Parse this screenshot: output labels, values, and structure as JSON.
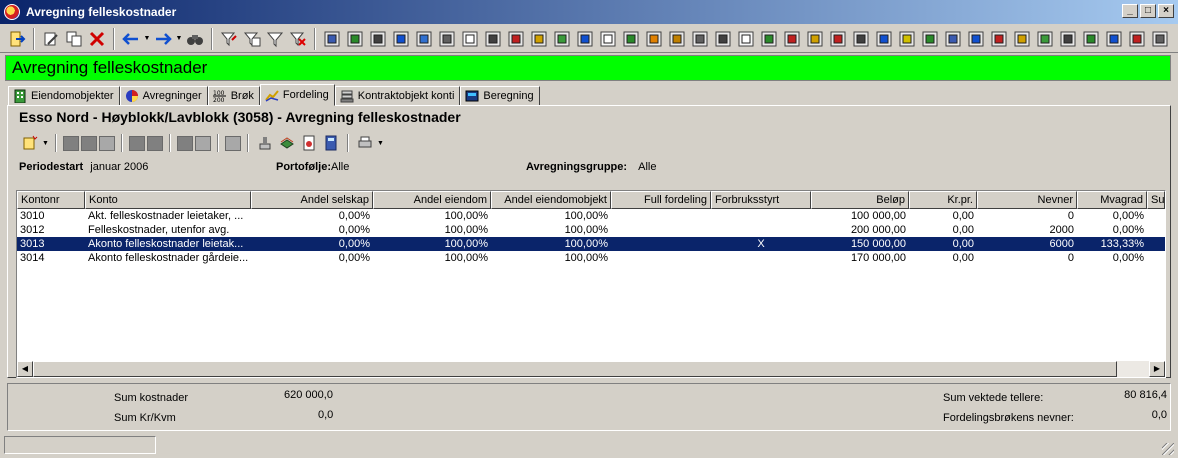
{
  "window": {
    "title": "Avregning felleskostnader"
  },
  "banner": {
    "title": "Avregning felleskostnader"
  },
  "tabs": [
    {
      "label": "Eiendomobjekter",
      "icon": "building-icon"
    },
    {
      "label": "Avregninger",
      "icon": "pie-icon"
    },
    {
      "label": "Brøk",
      "icon": "fraction-icon"
    },
    {
      "label": "Fordeling",
      "icon": "distribution-chart-icon",
      "active": true
    },
    {
      "label": "Kontraktobjekt konti",
      "icon": "stack-icon"
    },
    {
      "label": "Beregning",
      "icon": "calculator-icon"
    }
  ],
  "heading": "Esso Nord - Høyblokk/Lavblokk  (3058) - Avregning felleskostnader",
  "filters": {
    "periodestart_label": "Periodestart",
    "periodestart_value": "januar 2006",
    "portefolje_label": "Portofølje:",
    "portefolje_value": "Alle",
    "gruppe_label": "Avregningsgruppe:",
    "gruppe_value": "Alle"
  },
  "grid": {
    "columns": [
      "Kontonr",
      "Konto",
      "Andel selskap",
      "Andel eiendom",
      "Andel eiendomobjekt",
      "Full fordeling",
      "Forbruksstyrt",
      "Beløp",
      "Kr.pr.",
      "Nevner",
      "Mvagrad",
      "Su"
    ],
    "rows": [
      {
        "kontonr": "3010",
        "konto": "Akt. felleskostnader leietaker, ...",
        "andel_selskap": "0,00%",
        "andel_eiendom": "100,00%",
        "andel_eiendomobjekt": "100,00%",
        "full_fordeling": "",
        "forbruksstyrt": "",
        "belop": "100 000,00",
        "kr_pr": "0,00",
        "nevner": "0",
        "mvagrad": "0,00%",
        "selected": false
      },
      {
        "kontonr": "3012",
        "konto": "Felleskostnader, utenfor avg.",
        "andel_selskap": "0,00%",
        "andel_eiendom": "100,00%",
        "andel_eiendomobjekt": "100,00%",
        "full_fordeling": "",
        "forbruksstyrt": "",
        "belop": "200 000,00",
        "kr_pr": "0,00",
        "nevner": "2000",
        "mvagrad": "0,00%",
        "selected": false
      },
      {
        "kontonr": "3013",
        "konto": "Akonto felleskostnader leietak...",
        "andel_selskap": "0,00%",
        "andel_eiendom": "100,00%",
        "andel_eiendomobjekt": "100,00%",
        "full_fordeling": "",
        "forbruksstyrt": "X",
        "belop": "150 000,00",
        "kr_pr": "0,00",
        "nevner": "6000",
        "mvagrad": "133,33%",
        "selected": true
      },
      {
        "kontonr": "3014",
        "konto": "Akonto felleskostnader gårdeie...",
        "andel_selskap": "0,00%",
        "andel_eiendom": "100,00%",
        "andel_eiendomobjekt": "100,00%",
        "full_fordeling": "",
        "forbruksstyrt": "",
        "belop": "170 000,00",
        "kr_pr": "0,00",
        "nevner": "0",
        "mvagrad": "0,00%",
        "selected": false
      }
    ]
  },
  "summary": {
    "sum_kostnader_label": "Sum kostnader",
    "sum_kostnader_value": "620 000,0",
    "sum_krkvm_label": "Sum Kr/Kvm",
    "sum_krkvm_value": "0,0",
    "sum_vektede_label": "Sum vektede tellere:",
    "sum_vektede_value": "80 816,4",
    "fordelingsbrok_label": "Fordelingsbrøkens nevner:",
    "fordelingsbrok_value": "0,0"
  },
  "colors": {
    "banner": "#00ff00",
    "selection": "#0a246a",
    "titlebar": "#0a246a",
    "face": "#d4d0c8"
  }
}
